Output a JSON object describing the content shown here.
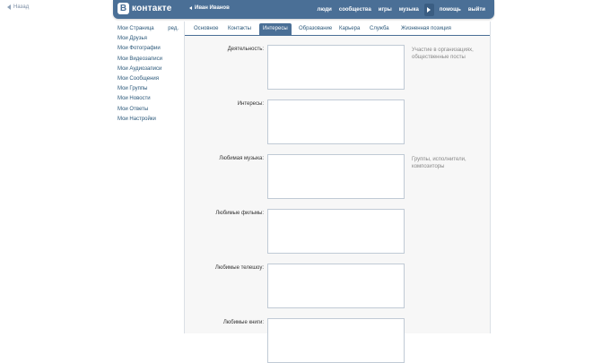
{
  "back": {
    "label": "Назад"
  },
  "header": {
    "logo_mark": "В",
    "logo_text": "контакте",
    "user_name": "Иван Иванов",
    "nav": [
      "люди",
      "сообщества",
      "игры",
      "музыка",
      "помощь",
      "выйти"
    ]
  },
  "sidebar": {
    "edit_label": "ред.",
    "items": [
      "Мои Страница",
      "Мои Друзья",
      "Мои Фотографии",
      "Мои Видеозаписи",
      "Мои Аудиозаписи",
      "Мои Сообщения",
      "Мои Группы",
      "Мои Новости",
      "Мои Ответы",
      "Мои Настройки"
    ]
  },
  "tabs": [
    "Основное",
    "Контакты",
    "Интересы",
    "Образование",
    "Карьера",
    "Служба",
    "Жизненная позиция"
  ],
  "active_tab": "Интересы",
  "fields": [
    {
      "label": "Деятельность:",
      "value": "",
      "hint": "Участие в организациях, общественные посты"
    },
    {
      "label": "Интересы:",
      "value": "",
      "hint": ""
    },
    {
      "label": "Любимая музыка:",
      "value": "",
      "hint": "Группы, исполнители, композиторы"
    },
    {
      "label": "Любимые фильмы:",
      "value": "",
      "hint": ""
    },
    {
      "label": "Любимые телешоу:",
      "value": "",
      "hint": ""
    },
    {
      "label": "Любимые книги:",
      "value": "",
      "hint": ""
    }
  ]
}
